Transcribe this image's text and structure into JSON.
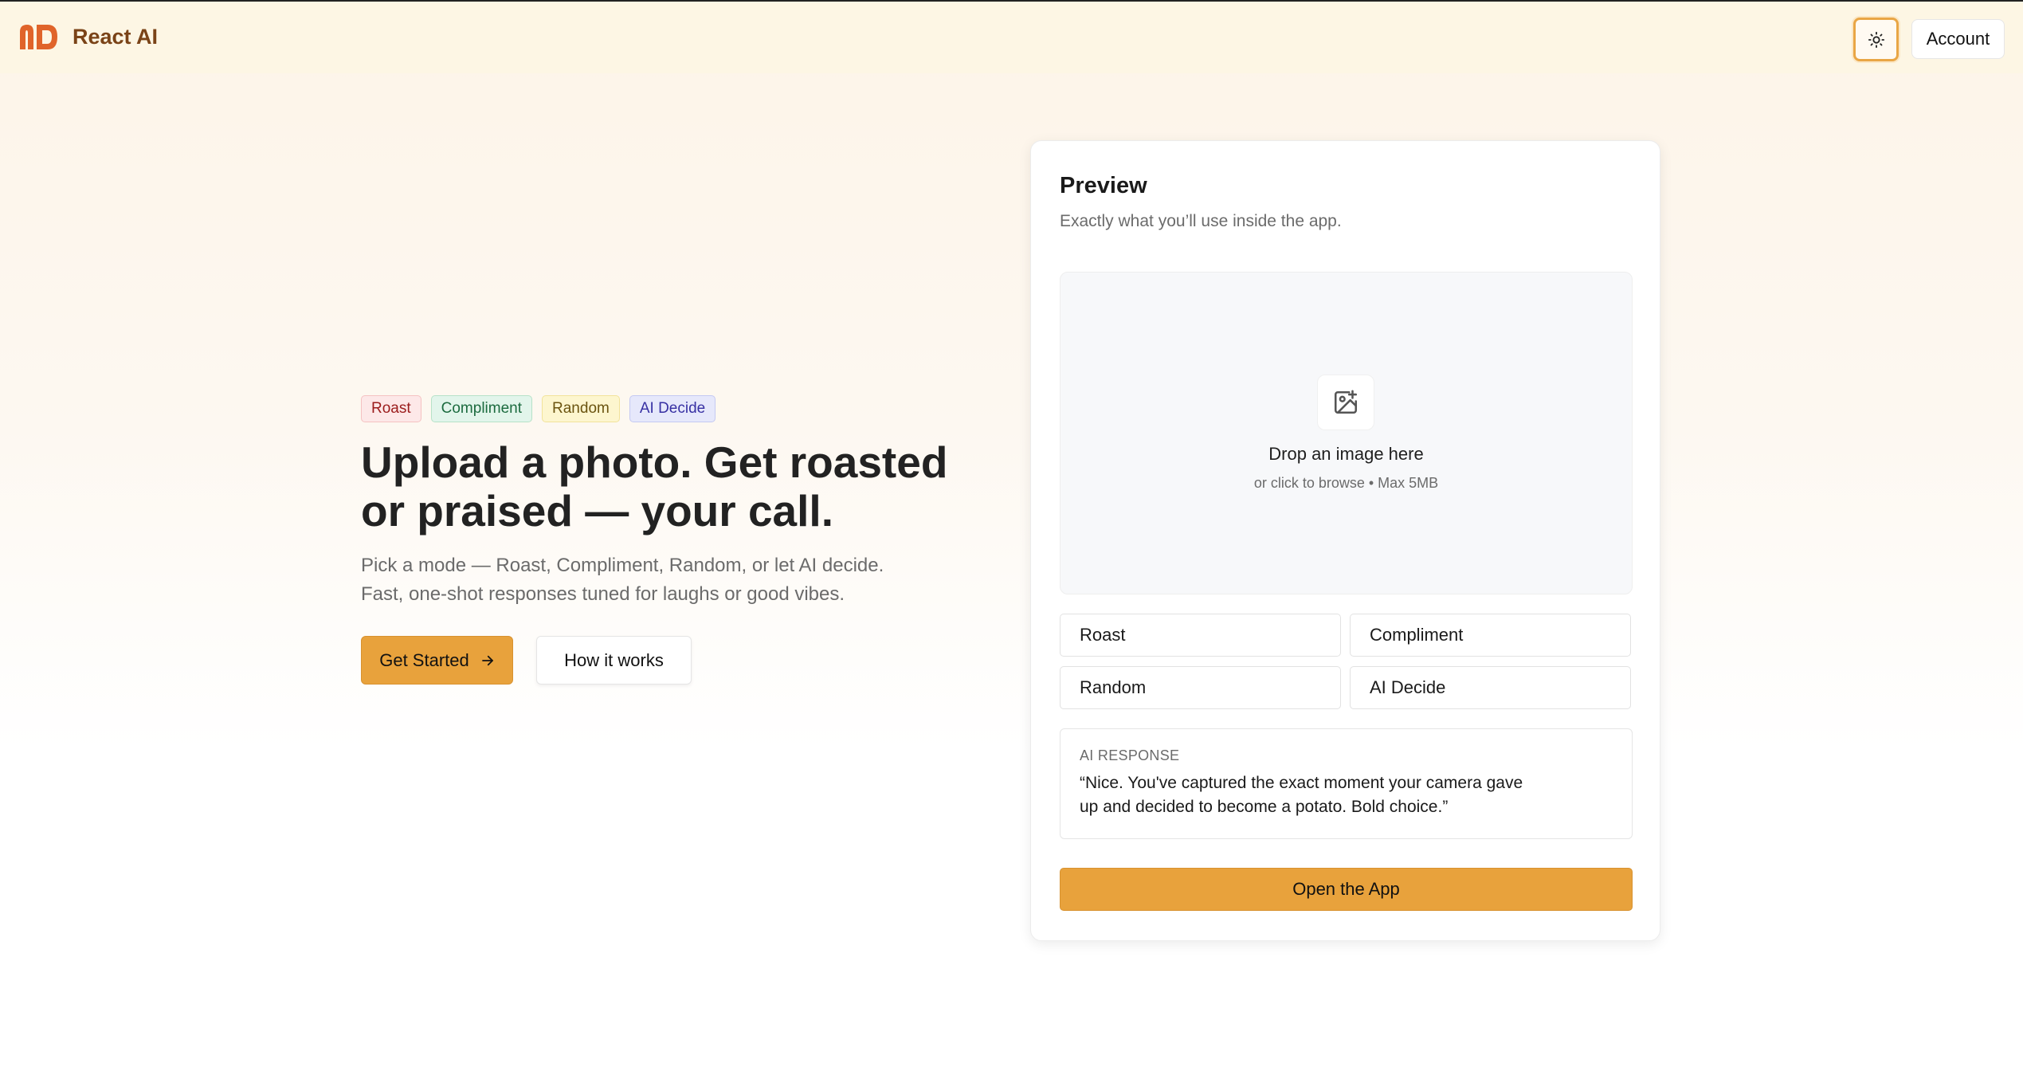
{
  "header": {
    "brand_name": "React AI",
    "account_label": "Account",
    "logo_color": "#e0642a",
    "theme_icon": "sun-icon"
  },
  "hero": {
    "chips": [
      "Roast",
      "Compliment",
      "Random",
      "AI Decide"
    ],
    "headline": "Upload a photo. Get roasted or praised — your call.",
    "subtext_line1": "Pick a mode — Roast, Compliment, Random, or let AI decide.",
    "subtext_line2": "Fast, one-shot responses tuned for laughs or good vibes.",
    "primary_button": "Get Started",
    "primary_button_icon": "arrow-right-icon",
    "secondary_button": "How it works"
  },
  "preview": {
    "title": "Preview",
    "description": "Exactly what you’ll use inside the app.",
    "dropzone_icon": "image-plus-icon",
    "dropzone_main": "Drop an image here",
    "dropzone_sub": "or click to browse • Max 5MB",
    "modes": [
      "Roast",
      "Compliment",
      "Random",
      "AI Decide"
    ],
    "response_label": "AI RESPONSE",
    "response_text": "“Nice. You've captured the exact moment your camera gave up and decided to become a potato. Bold choice.”",
    "open_app_button": "Open the App"
  },
  "colors": {
    "accent": "#e8a23c",
    "brand_text": "#7a4317",
    "background_top": "#fdf4e8"
  }
}
